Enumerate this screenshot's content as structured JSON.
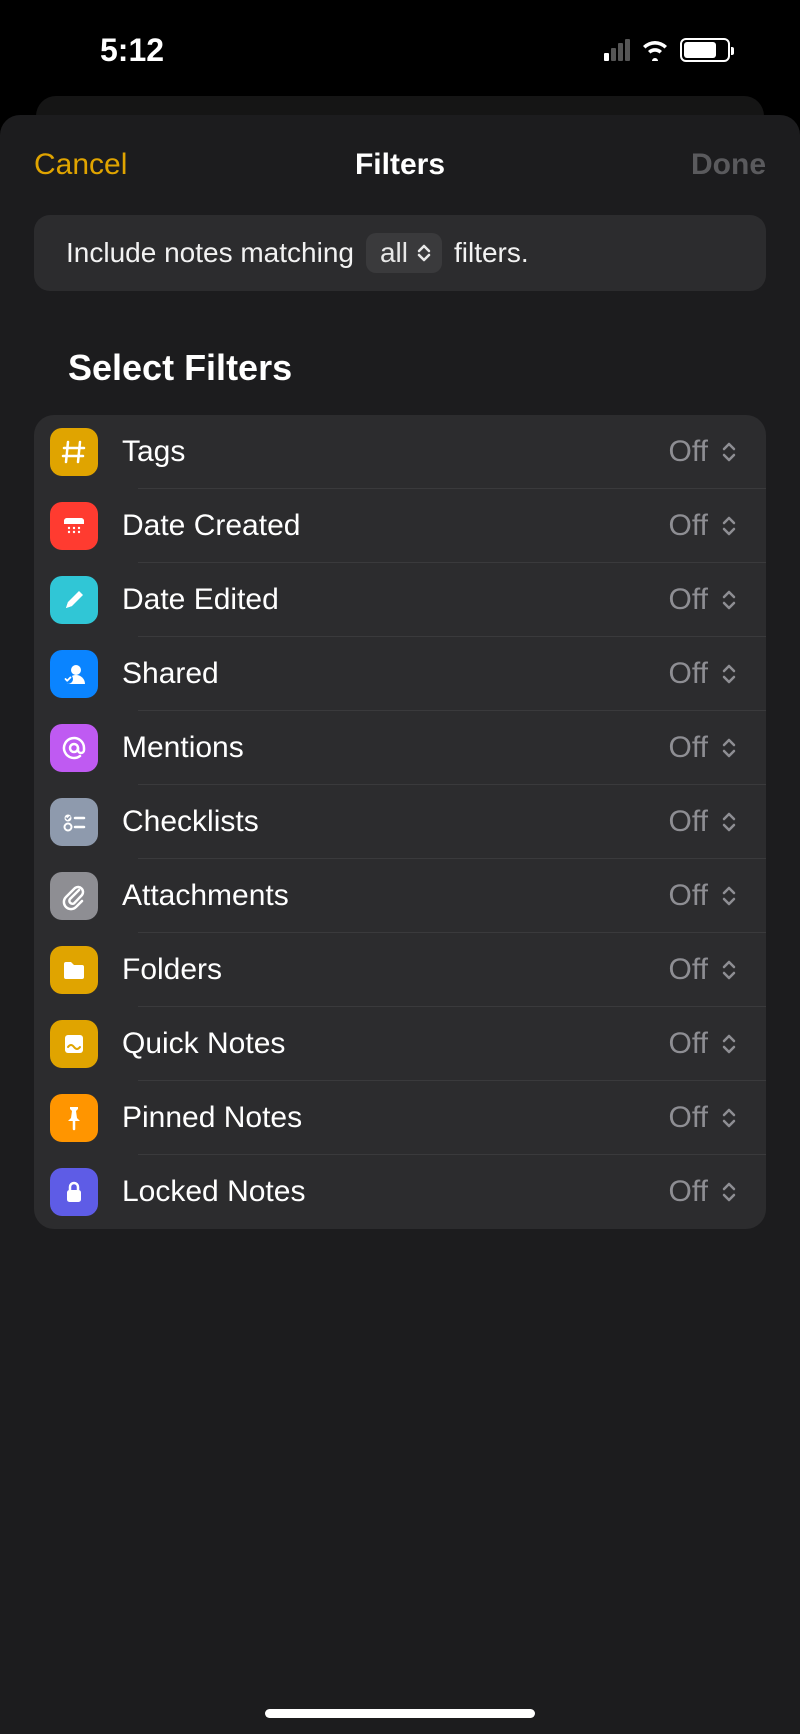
{
  "status": {
    "time": "5:12"
  },
  "header": {
    "cancel": "Cancel",
    "title": "Filters",
    "done": "Done"
  },
  "match": {
    "prefix": "Include notes matching",
    "picker": "all",
    "suffix": "filters."
  },
  "section_title": "Select Filters",
  "filters": [
    {
      "label": "Tags",
      "value": "Off",
      "icon": "hash",
      "color": "#e0a400"
    },
    {
      "label": "Date Created",
      "value": "Off",
      "icon": "calendar",
      "color": "#ff3b30"
    },
    {
      "label": "Date Edited",
      "value": "Off",
      "icon": "pencil",
      "color": "#30c6d6"
    },
    {
      "label": "Shared",
      "value": "Off",
      "icon": "shared",
      "color": "#0a84ff"
    },
    {
      "label": "Mentions",
      "value": "Off",
      "icon": "at",
      "color": "#bf5af2"
    },
    {
      "label": "Checklists",
      "value": "Off",
      "icon": "checklist",
      "color": "#8e9aad"
    },
    {
      "label": "Attachments",
      "value": "Off",
      "icon": "paperclip",
      "color": "#8e8e93"
    },
    {
      "label": "Folders",
      "value": "Off",
      "icon": "folder",
      "color": "#e0a400"
    },
    {
      "label": "Quick Notes",
      "value": "Off",
      "icon": "quicknote",
      "color": "#e0a400"
    },
    {
      "label": "Pinned Notes",
      "value": "Off",
      "icon": "pin",
      "color": "#ff9500"
    },
    {
      "label": "Locked Notes",
      "value": "Off",
      "icon": "lock",
      "color": "#5e5ce6"
    }
  ]
}
